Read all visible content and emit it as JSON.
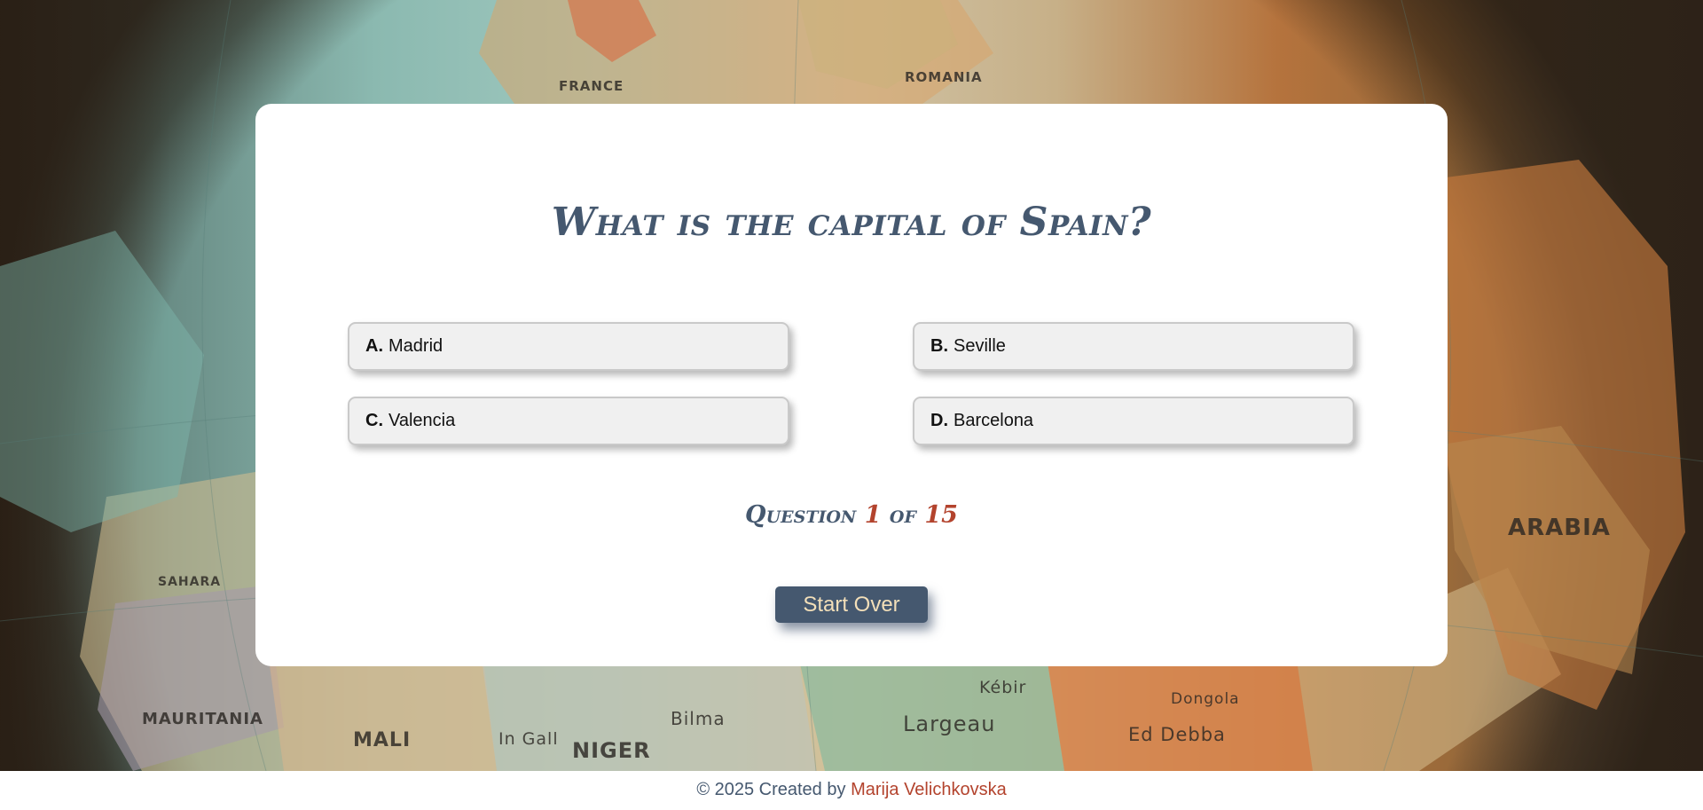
{
  "quiz": {
    "question": "What is the capital of Spain?",
    "answers": [
      {
        "letter": "A.",
        "text": "Madrid"
      },
      {
        "letter": "B.",
        "text": "Seville"
      },
      {
        "letter": "C.",
        "text": "Valencia"
      },
      {
        "letter": "D.",
        "text": "Barcelona"
      }
    ],
    "counter": {
      "prefix": "Question",
      "current": "1",
      "of": "of",
      "total": "15"
    },
    "start_over_label": "Start Over"
  },
  "background": {
    "labels": [
      "FRANCE",
      "ROMANIA",
      "MAURITANIA",
      "MALI",
      "NIGER",
      "Largeau",
      "ARABIA",
      "Dongola",
      "Ed Debba",
      "SAHARA",
      "Bilma",
      "Kébir",
      "In Gall"
    ]
  },
  "footer": {
    "prefix": "© 2025 Created by",
    "author": "Marija Velichkovska"
  },
  "colors": {
    "accent": "#45586f",
    "highlight": "#b3432d",
    "button_text": "#f3dfb9"
  }
}
